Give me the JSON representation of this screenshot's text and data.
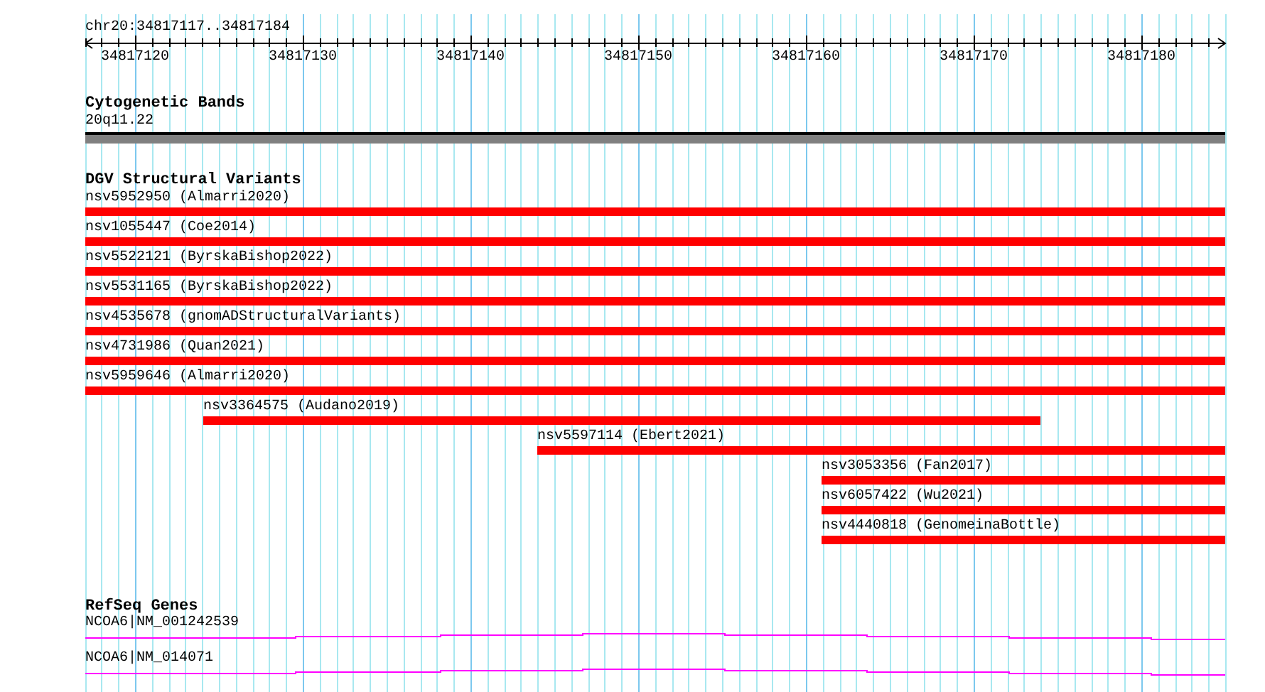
{
  "location": "chr20:34817117..34817184",
  "ruler": {
    "ticks": [
      "34817120",
      "34817130",
      "34817140",
      "34817150",
      "34817160",
      "34817170",
      "34817180"
    ]
  },
  "cytogenetic_bands": {
    "title": "Cytogenetic Bands",
    "band": "20q11.22"
  },
  "dgv_structural_variants": {
    "title": "DGV Structural Variants",
    "features": [
      {
        "label": "nsv5952950 (Almarri2020)"
      },
      {
        "label": "nsv1055447 (Coe2014)"
      },
      {
        "label": "nsv5522121 (ByrskaBishop2022)"
      },
      {
        "label": "nsv5531165 (ByrskaBishop2022)"
      },
      {
        "label": "nsv4535678 (gnomADStructuralVariants)"
      },
      {
        "label": "nsv4731986 (Quan2021)"
      },
      {
        "label": "nsv5959646 (Almarri2020)"
      },
      {
        "label": "nsv3364575 (Audano2019)"
      },
      {
        "label": "nsv5597114 (Ebert2021)"
      },
      {
        "label": "nsv3053356 (Fan2017)"
      },
      {
        "label": "nsv6057422 (Wu2021)"
      },
      {
        "label": "nsv4440818 (GenomeinaBottle)"
      }
    ]
  },
  "refseq_genes": {
    "title": "RefSeq Genes",
    "transcripts": [
      {
        "label": "NCOA6|NM_001242539"
      },
      {
        "label": "NCOA6|NM_014071"
      }
    ]
  }
}
